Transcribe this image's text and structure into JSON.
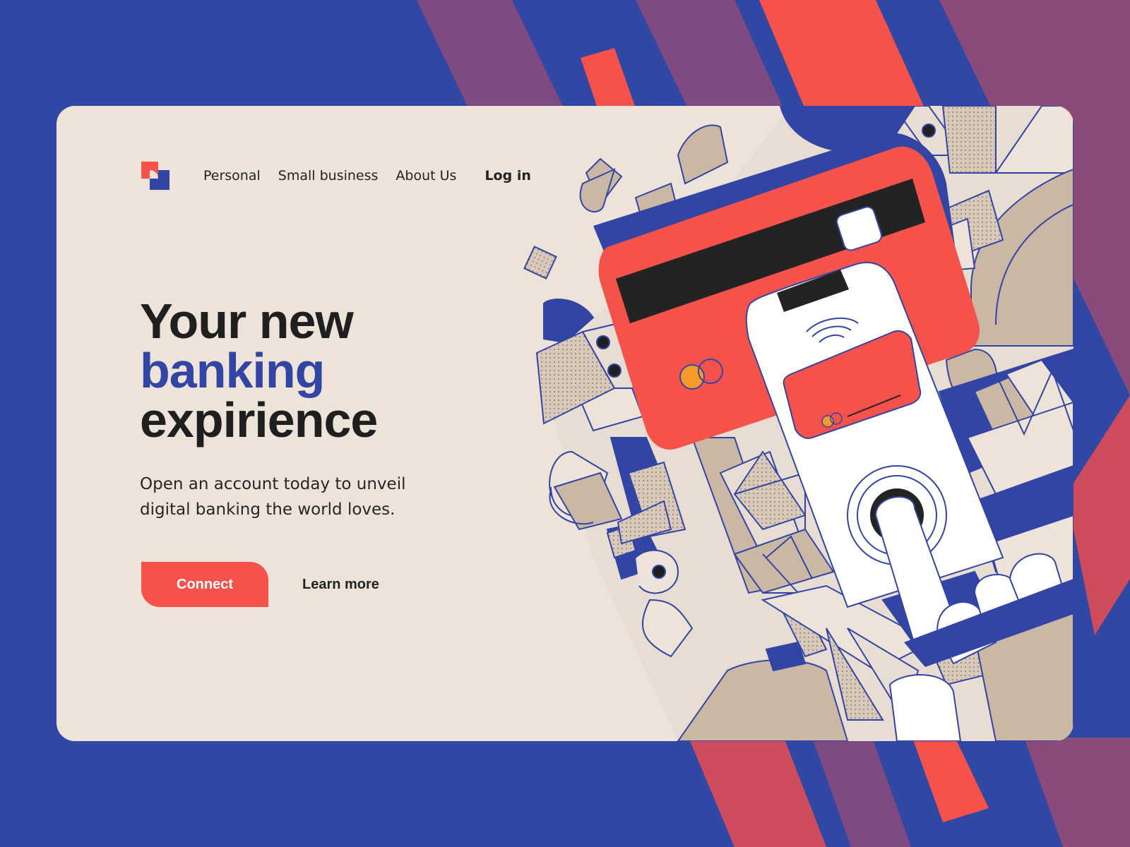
{
  "nav": {
    "items": [
      "Personal",
      "Small business",
      "About Us"
    ],
    "login_label": "Log in"
  },
  "hero": {
    "headline_line1": "Your new",
    "headline_line2": "banking",
    "headline_line3": "expirience",
    "subtitle": "Open an account today to unveil digital banking the world loves."
  },
  "cta": {
    "primary_label": "Connect",
    "secondary_label": "Learn more"
  },
  "colors": {
    "background_blue": "#3047a4",
    "card_beige": "#ede3d9",
    "accent_red": "#f5524b",
    "accent_purple": "#7f4a82",
    "text_dark": "#1f1f1f",
    "headline_blue": "#3345a4"
  }
}
